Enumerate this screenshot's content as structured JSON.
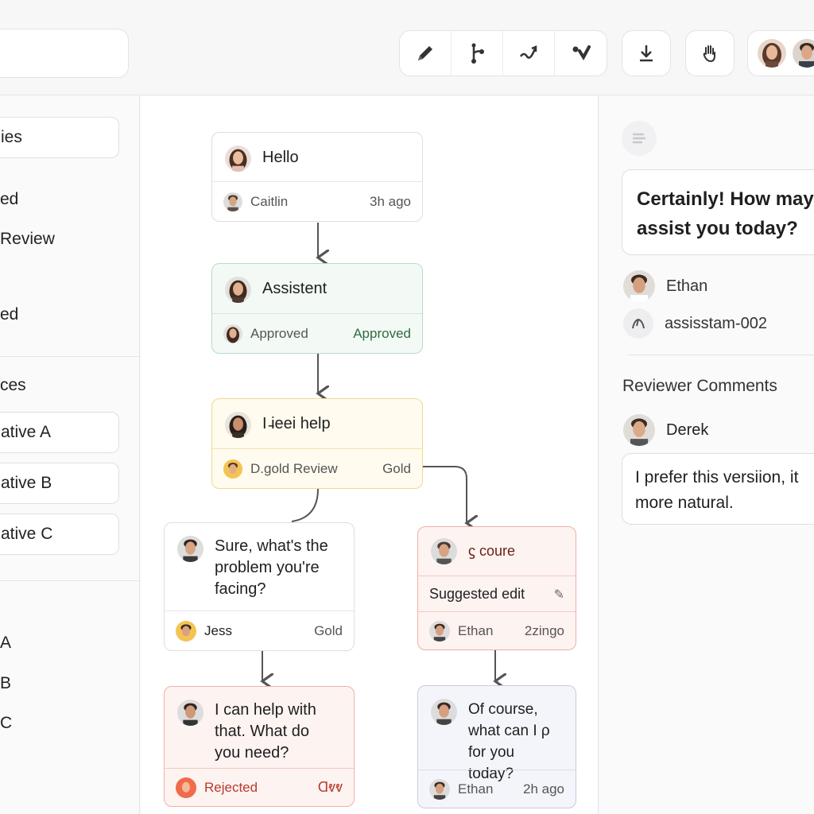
{
  "toolbar": {
    "tools": [
      {
        "icon": "pencil-icon",
        "label": "Edit"
      },
      {
        "icon": "branch-icon",
        "label": "Branch"
      },
      {
        "icon": "connect-icon",
        "label": "Connect"
      },
      {
        "icon": "merge-icon",
        "label": "Merge"
      }
    ],
    "download_icon": "download-icon",
    "hand_icon": "hand-icon"
  },
  "sidebar": {
    "items": [
      {
        "label": "ies"
      },
      {
        "label": "ed"
      },
      {
        "label": "Review"
      },
      {
        "label": "ed"
      },
      {
        "label": "ces"
      },
      {
        "label": "ative A"
      },
      {
        "label": "ative B"
      },
      {
        "label": "ative C"
      },
      {
        "label": "A"
      },
      {
        "label": "B"
      },
      {
        "label": "C"
      }
    ]
  },
  "nodes": {
    "hello": {
      "text": "Hello",
      "author": "Caitlin",
      "time": "3h ago"
    },
    "assistent": {
      "text": "Assistent",
      "status": "Approved",
      "badge": "Approved"
    },
    "help": {
      "text": "I ̵ieei help",
      "author": "D.gold Review",
      "badge": "Gold"
    },
    "sure": {
      "text": "Sure, what's the problem you're facing?",
      "author": "Jess",
      "badge": "Gold"
    },
    "coure": {
      "text": "ϛ coure",
      "suggest": "Suggested edit",
      "author": "Ethan",
      "time": "2zingo"
    },
    "canhelp": {
      "text": "I can help with that. What do you need?",
      "status": "Rejected",
      "mark": "Ɑⱴⱴ"
    },
    "ofcourse": {
      "text": "Of course, what can I ρ for you today?",
      "author": "Ethan",
      "time": "2h ago"
    }
  },
  "right_panel": {
    "message": "Certainly! How may assist you today?",
    "author": "Ethan",
    "model": "assisstam-002",
    "comments_heading": "Reviewer Comments",
    "reviewer": "Derek",
    "comment": "I prefer this versiion, it more natural."
  },
  "colors": {
    "approved_green": "#2e6b3c",
    "rejected_red": "#b83a2a",
    "gold_border": "#f2d98a"
  }
}
